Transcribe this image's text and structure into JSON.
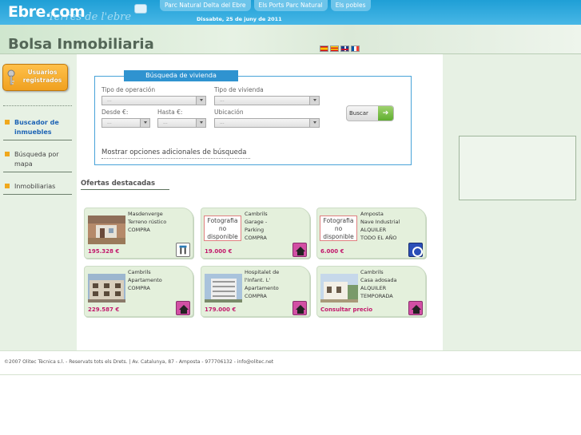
{
  "brand": {
    "logo": "Ebre.com",
    "tagline": "Terres de l'ebre"
  },
  "topnav": {
    "items": [
      {
        "label": "Parc Natural Delta del Ebre"
      },
      {
        "label": "Els Ports Parc Natural"
      },
      {
        "label": "Els pobles"
      }
    ],
    "date": "Dissabte, 25 de juny de 2011"
  },
  "header": {
    "title": "Bolsa Inmobiliaria",
    "languages": [
      "es",
      "ca",
      "en",
      "fr"
    ]
  },
  "sidebar": {
    "users_button": "Usuarios registrados",
    "items": [
      {
        "label": "Buscador de inmuebles",
        "active": true
      },
      {
        "label": "Búsqueda por mapa",
        "active": false
      },
      {
        "label": "Inmobiliarias",
        "active": false
      }
    ]
  },
  "search": {
    "title": "Búsqueda de vivienda",
    "operation_label": "Tipo de operación",
    "operation_value": "...",
    "property_label": "Tipo de vivienda",
    "property_value": "...",
    "from_label": "Desde €:",
    "from_value": "...",
    "to_label": "Hasta €:",
    "to_value": "...",
    "location_label": "Ubicación",
    "location_value": "...",
    "search_button": "Buscar",
    "more_options": "Mostrar  opciones adicionales de búsqueda"
  },
  "featured": {
    "title": "Ofertas destacadas",
    "no_photo": "Fotografia no disponible",
    "cards": [
      {
        "line1": "Masdenverge",
        "line2": "Terreno rústico",
        "line3": "COMPRA",
        "line4": "",
        "price": "195.328 €",
        "has_photo": true,
        "logo": "plain"
      },
      {
        "line1": "Cambrils",
        "line2": "Garage -",
        "line3": "Parking",
        "line4": "COMPRA",
        "price": "19.000 €",
        "has_photo": false,
        "logo": "pink"
      },
      {
        "line1": "Amposta",
        "line2": "Nave Industrial",
        "line3": "ALQUILER",
        "line4": "TODO EL AÑO",
        "price": "6.000 €",
        "has_photo": false,
        "logo": "blue"
      },
      {
        "line1": "Cambrils",
        "line2": "Apartamento",
        "line3": "COMPRA",
        "line4": "",
        "price": "229.587 €",
        "has_photo": true,
        "logo": "pink"
      },
      {
        "line1": "Hospitalet de",
        "line2": "l'Infant. L'",
        "line3": "Apartamento",
        "line4": "COMPRA",
        "price": "179.000 €",
        "has_photo": true,
        "logo": "pink"
      },
      {
        "line1": "Cambrils",
        "line2": "Casa adosada",
        "line3": "ALQUILER",
        "line4": "TEMPORADA",
        "price": "Consultar precio",
        "has_photo": true,
        "logo": "pink"
      }
    ]
  },
  "footer": {
    "text": "©2007 Olitec Tècnica s.l. - Reservats tots els Drets. | Av. Catalunya, 87 - Amposta - 977706132 - info@olitec.net"
  }
}
